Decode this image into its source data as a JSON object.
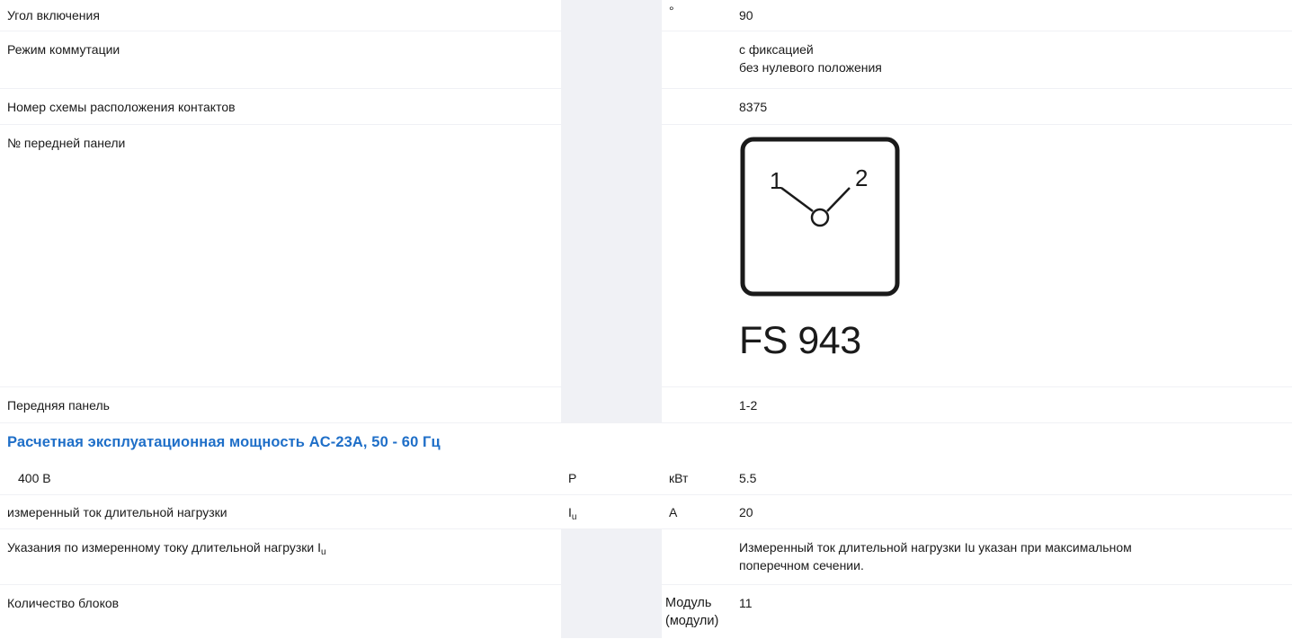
{
  "rows": {
    "switch_angle": {
      "label": "Угол включения",
      "symbol": "",
      "unit": "°",
      "value": "90"
    },
    "switching_mode": {
      "label": "Режим коммутации",
      "symbol": "",
      "unit": "",
      "value_line1": "с фиксацией",
      "value_line2": "без нулевого положения"
    },
    "contact_scheme": {
      "label": "Номер схемы расположения контактов",
      "symbol": "",
      "unit": "",
      "value": "8375"
    },
    "front_panel_no": {
      "label": "№ передней панели",
      "diagram": {
        "pos1": "1",
        "pos2": "2",
        "code": "FS 943"
      }
    },
    "front_panel": {
      "label": "Передняя панель",
      "value": "1-2"
    },
    "section": {
      "title": "Расчетная эксплуатационная мощность AC-23A, 50 - 60 Гц"
    },
    "power_400": {
      "label": "400 В",
      "symbol": "P",
      "unit": "кВт",
      "value": "5.5"
    },
    "rated_current": {
      "label": "измеренный ток длительной нагрузки",
      "symbol_main": "I",
      "symbol_sub": "u",
      "unit": "A",
      "value": "20"
    },
    "current_note": {
      "label_main": "Указания по измеренному току длительной нагрузки I",
      "label_sub": "u",
      "value_line1": "Измеренный ток длительной нагрузки Iu указан при максимальном",
      "value_line2": "поперечном сечении."
    },
    "blocks": {
      "label": "Количество блоков",
      "unit_line1": "Модуль",
      "unit_line2": "(модули)",
      "value": "11"
    }
  }
}
